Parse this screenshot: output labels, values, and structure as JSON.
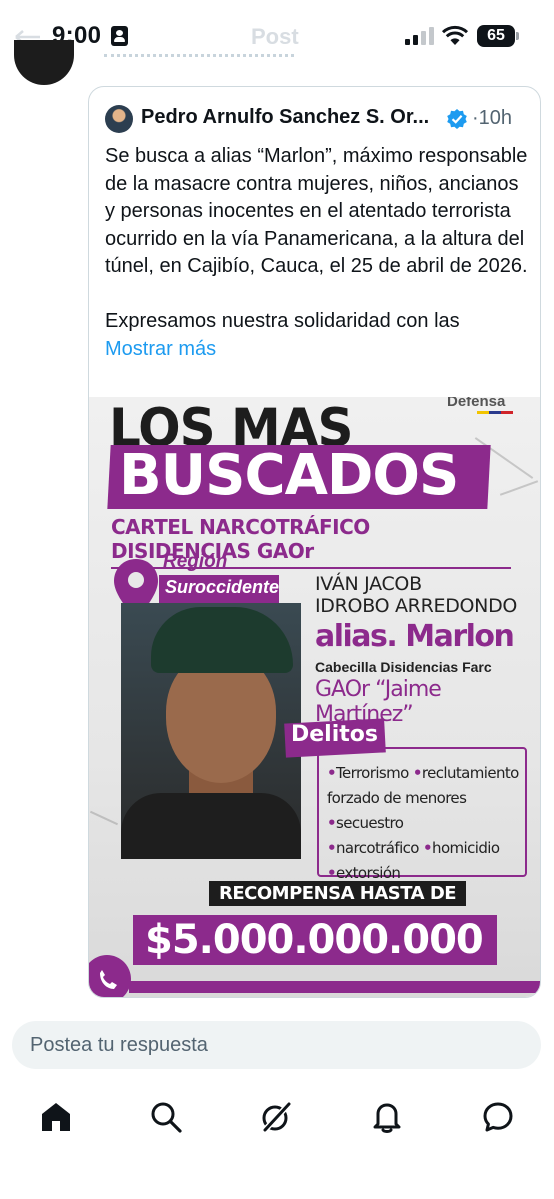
{
  "status_bar": {
    "time": "9:00",
    "battery": "65",
    "header_title": "Post"
  },
  "quoted_post": {
    "author_name": "Pedro Arnulfo Sanchez S. Or...",
    "time": "10h",
    "text_paragraph_1": "Se busca a alias “Marlon”, máximo responsable de la masacre contra mujeres, niños, ancianos y personas inocentes en el atentado terrorista ocurrido en la vía Panamericana, a la altura del túnel, en Cajibío, Cauca, el 25 de abril de 2026.",
    "text_paragraph_2": "Expresamos nuestra solidaridad con las",
    "show_more": "Mostrar más",
    "verified_icon": "verified-badge-icon"
  },
  "poster": {
    "defensa": "Defensa",
    "headline_1": "LOS MAS",
    "headline_2": "BUSCADOS",
    "subtitle": "CARTEL NARCOTRÁFICO DISIDENCIAS GAOr",
    "region_label": "Región",
    "region": "Suroccidente",
    "name_line_1": "IVÁN JACOB",
    "name_line_2": "IDROBO ARREDONDO",
    "alias": "alias. Marlon",
    "role": "Cabecilla Disidencias Farc",
    "group": "GAOr “Jaime Martínez”",
    "delitos_title": "Delitos",
    "crimes": [
      "Terrorismo",
      "reclutamiento forzado de menores",
      "secuestro",
      "narcotráfico",
      "homicidio",
      "extorsión"
    ],
    "reward_label": "RECOMPENSA HASTA DE",
    "reward_amount": "$5.000.000.000"
  },
  "reply": {
    "placeholder": "Postea tu respuesta"
  },
  "nav": {
    "items": [
      "home-icon",
      "search-icon",
      "grok-icon",
      "notifications-icon",
      "messages-icon"
    ]
  },
  "colors": {
    "accent": "#1d9bf0",
    "poster_purple": "#8c2a8c"
  }
}
